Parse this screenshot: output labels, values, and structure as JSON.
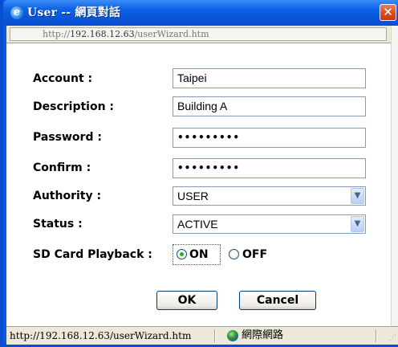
{
  "window": {
    "title": "User -- 網頁對話",
    "close_glyph": "✕",
    "app_icon": "ie-icon"
  },
  "address": {
    "prefix": "http://",
    "host": "192.168.12.63",
    "path": "/userWizard.htm"
  },
  "form": {
    "account_label": "Account :",
    "account_value": "Taipei",
    "description_label": "Description :",
    "description_value": "Building A",
    "password_label": "Password :",
    "password_value": "•••••••••",
    "confirm_label": "Confirm :",
    "confirm_value": "•••••••••",
    "authority_label": "Authority :",
    "authority_value": "USER",
    "status_label": "Status :",
    "status_value": "ACTIVE",
    "sd_label": "SD Card Playback :",
    "sd_on_label": "ON",
    "sd_off_label": "OFF",
    "sd_selected": "ON"
  },
  "buttons": {
    "ok_label": "OK",
    "cancel_label": "Cancel"
  },
  "statusbar": {
    "url": "http://192.168.12.63/userWizard.htm",
    "zone": "網際網路"
  },
  "colors": {
    "titlebar": "#0a55d8",
    "close": "#d64a1f",
    "radio_selected": "#2aa82a"
  }
}
